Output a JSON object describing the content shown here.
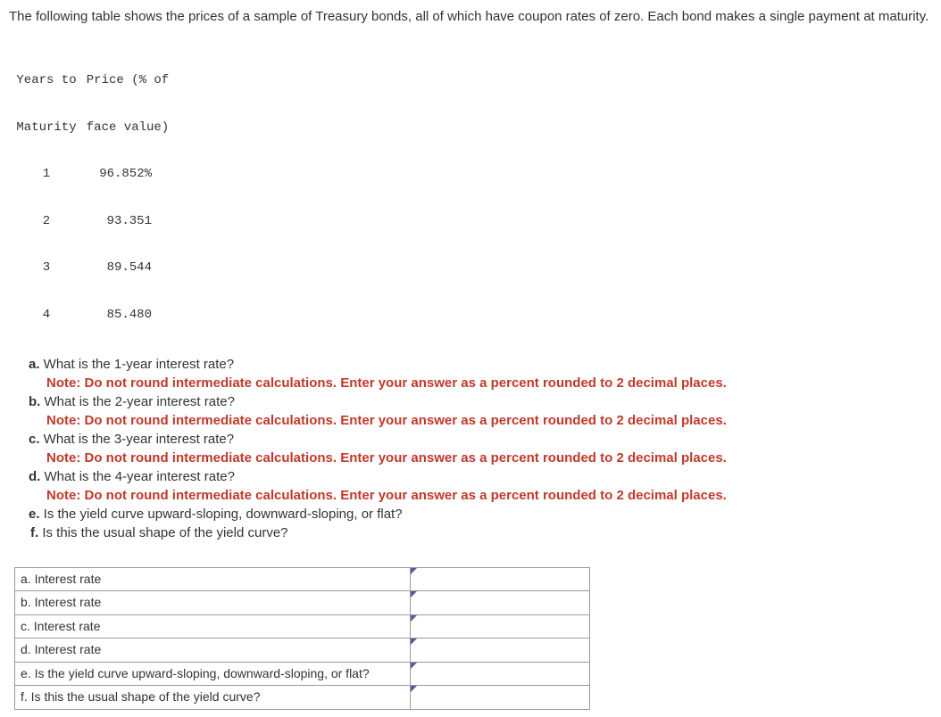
{
  "intro": "The following table shows the prices of a sample of Treasury bonds, all of which have coupon rates of zero. Each bond makes a single payment at maturity.",
  "bond_table": {
    "header_col1a": "Years to",
    "header_col1b": "Maturity",
    "header_col2a": "Price (% of",
    "header_col2b": "face value)",
    "rows": [
      {
        "y": "1",
        "p": "96.852%"
      },
      {
        "y": "2",
        "p": "93.351"
      },
      {
        "y": "3",
        "p": "89.544"
      },
      {
        "y": "4",
        "p": "85.480"
      }
    ]
  },
  "note_text": "Note: Do not round intermediate calculations. Enter your answer as a percent rounded to 2 decimal places.",
  "questions": {
    "a": {
      "letter": "a.",
      "text": " What is the 1-year interest rate?"
    },
    "b": {
      "letter": "b.",
      "text": " What is the 2-year interest rate?"
    },
    "c": {
      "letter": "c.",
      "text": " What is the 3-year interest rate?"
    },
    "d": {
      "letter": "d.",
      "text": " What is the 4-year interest rate?"
    },
    "e": {
      "letter": "e.",
      "text": " Is the yield curve upward-sloping, downward-sloping, or flat?"
    },
    "f": {
      "letter": "f.",
      "text": " Is this the usual shape of the yield curve?"
    }
  },
  "answer_rows": {
    "a": "a. Interest rate",
    "b": "b. Interest rate",
    "c": "c. Interest rate",
    "d": "d. Interest rate",
    "e": "e. Is the yield curve upward-sloping, downward-sloping, or flat?",
    "f": "f. Is this the usual shape of the yield curve?"
  }
}
